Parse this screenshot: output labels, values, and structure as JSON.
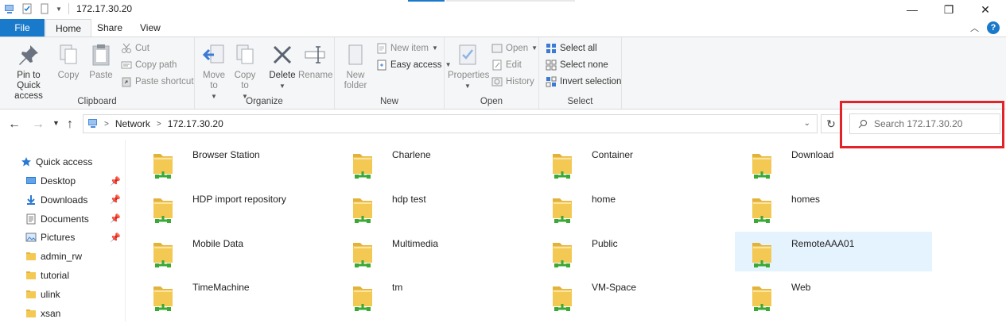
{
  "window": {
    "title": "172.17.30.20",
    "controls": {
      "minimize": "—",
      "restore": "❐",
      "close": "✕"
    }
  },
  "ribbon_tabs": {
    "file": "File",
    "home": "Home",
    "share": "Share",
    "view": "View"
  },
  "ribbon": {
    "clipboard": {
      "label": "Clipboard",
      "pin": "Pin to Quick access",
      "copy": "Copy",
      "paste": "Paste",
      "cut": "Cut",
      "copy_path": "Copy path",
      "paste_shortcut": "Paste shortcut"
    },
    "organize": {
      "label": "Organize",
      "move_to": "Move to",
      "copy_to": "Copy to",
      "delete": "Delete",
      "rename": "Rename"
    },
    "new": {
      "label": "New",
      "new_folder": "New folder",
      "new_item": "New item",
      "easy_access": "Easy access"
    },
    "open": {
      "label": "Open",
      "properties": "Properties",
      "open": "Open",
      "edit": "Edit",
      "history": "History"
    },
    "select": {
      "label": "Select",
      "select_all": "Select all",
      "select_none": "Select none",
      "invert_selection": "Invert selection"
    }
  },
  "address_bar": {
    "crumbs": [
      "Network",
      "172.17.30.20"
    ]
  },
  "search": {
    "placeholder": "Search 172.17.30.20",
    "value": ""
  },
  "nav_pane": {
    "quick_access": "Quick access",
    "items": [
      {
        "label": "Desktop",
        "icon": "desktop-icon",
        "pinned": true
      },
      {
        "label": "Downloads",
        "icon": "download-icon",
        "pinned": true
      },
      {
        "label": "Documents",
        "icon": "documents-icon",
        "pinned": true
      },
      {
        "label": "Pictures",
        "icon": "pictures-icon",
        "pinned": true
      },
      {
        "label": "admin_rw",
        "icon": "folder-icon",
        "pinned": false
      },
      {
        "label": "tutorial",
        "icon": "folder-icon",
        "pinned": false
      },
      {
        "label": "ulink",
        "icon": "folder-icon",
        "pinned": false
      },
      {
        "label": "xsan",
        "icon": "folder-icon",
        "pinned": false
      }
    ]
  },
  "shares": [
    "Browser Station",
    "Charlene",
    "Container",
    "Download",
    "HDP import repository",
    "hdp test",
    "home",
    "homes",
    "Mobile Data",
    "Multimedia",
    "Public",
    "RemoteAAA01",
    "TimeMachine",
    "tm",
    "VM-Space",
    "Web"
  ],
  "selected_share": "RemoteAAA01",
  "colors": {
    "accent": "#1979ca",
    "highlight": "#e2232a",
    "selection": "#e5f3ff",
    "folder": "#f3c853",
    "share_pipe": "#3aa935"
  }
}
